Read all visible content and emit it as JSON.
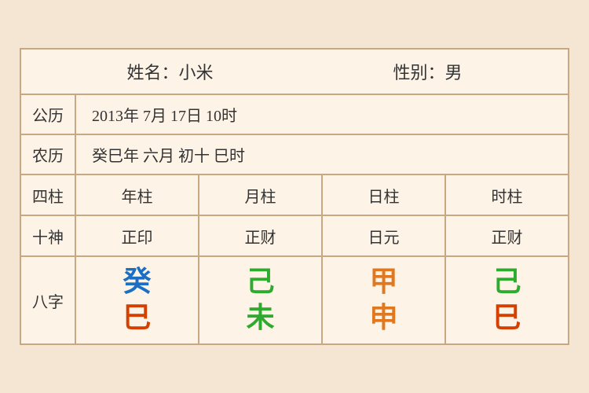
{
  "header": {
    "name_label": "姓名：小米",
    "gender_label": "性别：男"
  },
  "solar": {
    "label": "公历",
    "value": "2013年 7月 17日 10时"
  },
  "lunar": {
    "label": "农历",
    "value": "癸巳年 六月 初十 巳时"
  },
  "table": {
    "row_sizhu": {
      "label": "四柱",
      "cols": [
        "年柱",
        "月柱",
        "日柱",
        "时柱"
      ]
    },
    "row_shishen": {
      "label": "十神",
      "cols": [
        "正印",
        "正财",
        "日元",
        "正财"
      ]
    },
    "row_bazi": {
      "label": "八字",
      "cols": [
        {
          "top": "癸",
          "top_color": "color-blue",
          "bottom": "巳",
          "bottom_color": "color-red"
        },
        {
          "top": "己",
          "top_color": "color-green",
          "bottom": "未",
          "bottom_color": "color-green"
        },
        {
          "top": "甲",
          "top_color": "color-orange",
          "bottom": "申",
          "bottom_color": "color-orange"
        },
        {
          "top": "己",
          "top_color": "color-green2",
          "bottom": "巳",
          "bottom_color": "color-red"
        }
      ]
    }
  }
}
